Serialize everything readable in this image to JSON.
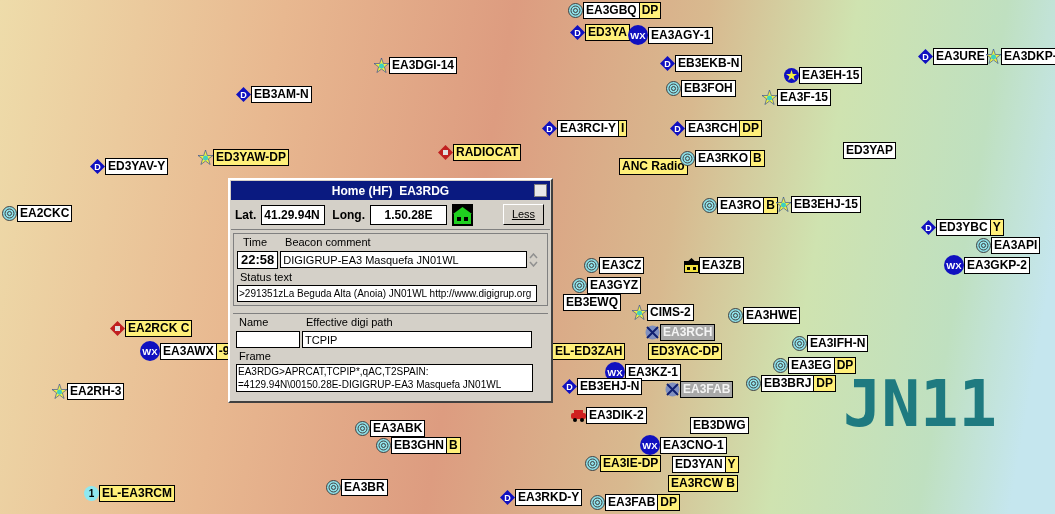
{
  "map": {
    "grid_label": "JN11"
  },
  "stations": [
    {
      "call": "EA3GBQ",
      "suffix": "DP",
      "kind": "rings",
      "highlight": false,
      "stale": false
    },
    {
      "call": "ED3YA",
      "kind": "digi",
      "symbol": "D",
      "highlight": true,
      "stale": false
    },
    {
      "call": "EA3AGY-1",
      "kind": "wx",
      "symbol": "WX",
      "highlight": false,
      "stale": false
    },
    {
      "call": "EA3DGI-14",
      "kind": "star",
      "highlight": false,
      "stale": false
    },
    {
      "call": "EB3EKB-N",
      "kind": "digi",
      "symbol": "D",
      "highlight": false,
      "stale": false
    },
    {
      "call": "EA3URE",
      "kind": "digi",
      "symbol": "D",
      "highlight": false,
      "stale": false
    },
    {
      "call": "EA3DKP-",
      "kind": "star",
      "highlight": false,
      "stale": false
    },
    {
      "call": "EB3AM-N",
      "kind": "digi",
      "symbol": "D",
      "highlight": false,
      "stale": false
    },
    {
      "call": "EB3FOH",
      "kind": "rings",
      "highlight": false,
      "stale": false
    },
    {
      "call": "EA3EH-15",
      "kind": "star-circle",
      "highlight": false,
      "stale": false
    },
    {
      "call": "EA3F-15",
      "kind": "star",
      "highlight": false,
      "stale": false
    },
    {
      "call": "EA3RCI-Y",
      "suffix": "I",
      "kind": "digi",
      "symbol": "D",
      "highlight": false,
      "stale": false
    },
    {
      "call": "EA3RCH",
      "suffix": "DP",
      "kind": "digi",
      "symbol": "D",
      "highlight": false,
      "stale": false
    },
    {
      "call": "ED3YAV-Y",
      "kind": "digi",
      "symbol": "D",
      "highlight": false,
      "stale": false
    },
    {
      "call": "ED3YAW-DP",
      "kind": "star",
      "highlight": true,
      "stale": false
    },
    {
      "call": "RADIOCAT",
      "kind": "radio",
      "highlight": true,
      "stale": false
    },
    {
      "call": "ANC Radio",
      "kind": "none",
      "highlight": true,
      "stale": false
    },
    {
      "call": "EA3RKO",
      "suffix": "B",
      "kind": "rings",
      "highlight": false,
      "stale": false
    },
    {
      "call": "ED3YAP",
      "kind": "none",
      "highlight": false,
      "stale": false
    },
    {
      "call": "EA2CKC",
      "kind": "rings",
      "highlight": false,
      "stale": false
    },
    {
      "call": "EA3RO",
      "suffix": "B",
      "kind": "rings",
      "highlight": false,
      "stale": false
    },
    {
      "call": "EB3EHJ-15",
      "kind": "star",
      "highlight": false,
      "stale": false
    },
    {
      "call": "ED3YBC",
      "suffix": "Y",
      "kind": "digi",
      "symbol": "D",
      "highlight": false,
      "stale": false
    },
    {
      "call": "EA3API",
      "kind": "rings",
      "highlight": false,
      "stale": false
    },
    {
      "call": "EA3CZ",
      "kind": "rings",
      "highlight": false,
      "stale": false
    },
    {
      "call": "EA3ZB",
      "kind": "house",
      "highlight": false,
      "stale": false
    },
    {
      "call": "EA3GKP-2",
      "kind": "wx",
      "symbol": "WX",
      "highlight": false,
      "stale": false
    },
    {
      "call": "EA3GYZ",
      "kind": "rings",
      "highlight": false,
      "stale": false
    },
    {
      "call": "EB3EWQ",
      "kind": "none",
      "highlight": false,
      "stale": false
    },
    {
      "call": "CIMS-2",
      "kind": "star",
      "highlight": false,
      "stale": false
    },
    {
      "call": "EA3HWE",
      "kind": "rings",
      "highlight": false,
      "stale": false
    },
    {
      "call": "EA2RCK C",
      "kind": "radio",
      "highlight": true,
      "stale": false
    },
    {
      "call": "EA3RCH",
      "kind": "crossed",
      "highlight": false,
      "stale": true
    },
    {
      "call": "EA3AWX",
      "suffix": "-9",
      "kind": "wx",
      "symbol": "WX",
      "highlight": false,
      "stale": false
    },
    {
      "call": "EL-ED3ZAH",
      "kind": "none",
      "highlight": true,
      "stale": false
    },
    {
      "call": "ED3YAC-DP",
      "kind": "none",
      "highlight": true,
      "stale": false
    },
    {
      "call": "EA3IFH-N",
      "kind": "rings",
      "highlight": false,
      "stale": false
    },
    {
      "call": "EA3KZ-1",
      "kind": "wx",
      "symbol": "WX",
      "highlight": false,
      "stale": false
    },
    {
      "call": "EA3EG",
      "suffix": "DP",
      "kind": "rings",
      "highlight": false,
      "stale": false
    },
    {
      "call": "EA2RH-3",
      "kind": "star",
      "highlight": false,
      "stale": false
    },
    {
      "call": "EB3EHJ-N",
      "kind": "digi",
      "symbol": "D",
      "highlight": false,
      "stale": false
    },
    {
      "call": "EA3FAB",
      "kind": "crossed",
      "highlight": false,
      "stale": true
    },
    {
      "call": "EB3BRJ",
      "suffix": "DP",
      "kind": "rings",
      "highlight": false,
      "stale": false
    },
    {
      "call": "EA3DIK-2",
      "kind": "car",
      "highlight": false,
      "stale": false
    },
    {
      "call": "EA3ABK",
      "kind": "rings",
      "highlight": false,
      "stale": false
    },
    {
      "call": "EB3DWG",
      "kind": "none",
      "highlight": false,
      "stale": false
    },
    {
      "call": "EB3GHN",
      "suffix": "B",
      "kind": "rings",
      "highlight": false,
      "stale": false
    },
    {
      "call": "EA3CNO-1",
      "kind": "wx",
      "symbol": "WX",
      "highlight": false,
      "stale": false
    },
    {
      "call": "EA3IE-DP",
      "kind": "rings",
      "highlight": true,
      "stale": false
    },
    {
      "call": "ED3YAN",
      "suffix": "Y",
      "kind": "none",
      "highlight": false,
      "stale": false
    },
    {
      "call": "EA3BR",
      "kind": "rings",
      "highlight": false,
      "stale": false
    },
    {
      "call": "EA3RCW B",
      "kind": "none",
      "highlight": true,
      "stale": false
    },
    {
      "call": "EL-EA3RCM",
      "kind": "number",
      "symbol": "1",
      "highlight": true,
      "stale": false
    },
    {
      "call": "EA3RKD-Y",
      "kind": "digi",
      "symbol": "D",
      "highlight": false,
      "stale": false
    },
    {
      "call": "EA3FAB",
      "suffix": "DP",
      "kind": "rings",
      "highlight": false,
      "stale": false
    }
  ],
  "dialog": {
    "title": "Home (HF)  EA3RDG",
    "lat_label": "Lat.",
    "lat": "41.29.94N",
    "long_label": "Long.",
    "long": "1.50.28E",
    "less_button": "Less",
    "time_label": "Time",
    "time": "22:58",
    "beacon_label": "Beacon comment",
    "beacon": "DIGIGRUP-EA3 Masquefa JN01WL",
    "status_label": "Status text",
    "status": ">291351zLa Beguda Alta (Anoia) JN01WL http://www.digigrup.org",
    "name_label": "Name",
    "path_label": "Effective digi path",
    "path": "TCPIP",
    "frame_label": "Frame",
    "frame": "EA3RDG>APRCAT,TCPIP*,qAC,T2SPAIN:\n=4129.94N\\00150.28E-DIGIGRUP-EA3 Masquefa JN01WL"
  }
}
